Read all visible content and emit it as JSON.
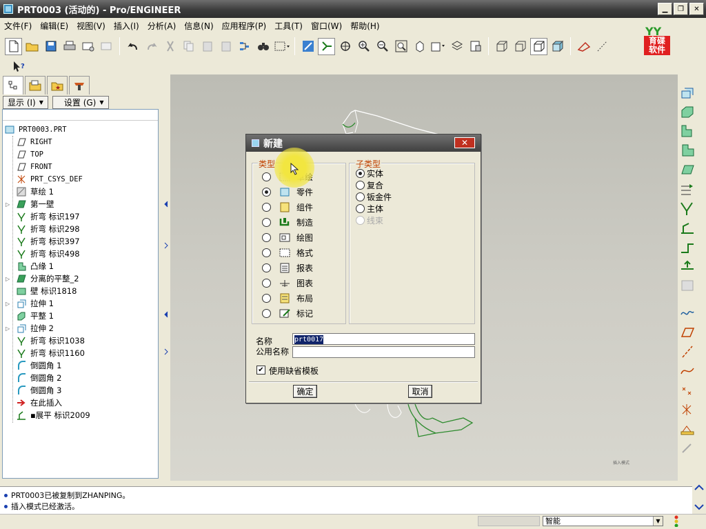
{
  "window": {
    "title": "PRT0003 (活动的) - Pro/ENGINEER",
    "min": "▁",
    "max": "❐",
    "close": "✕"
  },
  "menu": [
    "文件(F)",
    "编辑(E)",
    "视图(V)",
    "插入(I)",
    "分析(A)",
    "信息(N)",
    "应用程序(P)",
    "工具(T)",
    "窗口(W)",
    "帮助(H)"
  ],
  "logo": {
    "line1": "YY",
    "line2": "育碟\n软件"
  },
  "panel": {
    "show_label": "显示 (I)",
    "settings_label": "设置 (G)",
    "tree": [
      {
        "label": "PRT0003.PRT",
        "icon": "part-icon",
        "indent": 0,
        "expand": false
      },
      {
        "label": "RIGHT",
        "icon": "plane-icon",
        "indent": 1,
        "expand": false
      },
      {
        "label": "TOP",
        "icon": "plane-icon",
        "indent": 1,
        "expand": false
      },
      {
        "label": "FRONT",
        "icon": "plane-icon",
        "indent": 1,
        "expand": false
      },
      {
        "label": "PRT_CSYS_DEF",
        "icon": "csys-icon",
        "indent": 1,
        "expand": false
      },
      {
        "label": "草绘 1",
        "icon": "sketch-icon",
        "indent": 1,
        "expand": false
      },
      {
        "label": "第一壁",
        "icon": "wall-icon",
        "indent": 1,
        "expand": true
      },
      {
        "label": "折弯 标识197",
        "icon": "bend-icon",
        "indent": 1,
        "expand": false
      },
      {
        "label": "折弯 标识298",
        "icon": "bend-icon",
        "indent": 1,
        "expand": false
      },
      {
        "label": "折弯 标识397",
        "icon": "bend-icon",
        "indent": 1,
        "expand": false
      },
      {
        "label": "折弯 标识498",
        "icon": "bend-icon",
        "indent": 1,
        "expand": false
      },
      {
        "label": "凸缘 1",
        "icon": "flange-icon",
        "indent": 1,
        "expand": false
      },
      {
        "label": "分离的平整_2",
        "icon": "wall-icon",
        "indent": 1,
        "expand": true
      },
      {
        "label": "壁 标识1818",
        "icon": "wall2-icon",
        "indent": 1,
        "expand": false
      },
      {
        "label": "拉伸 1",
        "icon": "extrude-icon",
        "indent": 1,
        "expand": true
      },
      {
        "label": "平整 1",
        "icon": "flat-icon",
        "indent": 1,
        "expand": false
      },
      {
        "label": "拉伸 2",
        "icon": "extrude-icon",
        "indent": 1,
        "expand": true
      },
      {
        "label": "折弯 标识1038",
        "icon": "bend-icon",
        "indent": 1,
        "expand": false
      },
      {
        "label": "折弯 标识1160",
        "icon": "bend-icon",
        "indent": 1,
        "expand": false
      },
      {
        "label": "倒圆角 1",
        "icon": "round-icon",
        "indent": 1,
        "expand": false
      },
      {
        "label": "倒圆角 2",
        "icon": "round-icon",
        "indent": 1,
        "expand": false
      },
      {
        "label": "倒圆角 3",
        "icon": "round-icon",
        "indent": 1,
        "expand": false
      },
      {
        "label": "在此插入",
        "icon": "insert-here-icon",
        "indent": 1,
        "expand": false
      },
      {
        "label": "▪展平 标识2009",
        "icon": "unbend-icon",
        "indent": 1,
        "expand": false
      }
    ]
  },
  "dialog": {
    "title": "新建",
    "close": "✕",
    "type_group_label": "类型",
    "types": [
      {
        "label": "草绘",
        "selected": false,
        "icon": "sketch-type-icon"
      },
      {
        "label": "零件",
        "selected": true,
        "icon": "part-type-icon"
      },
      {
        "label": "组件",
        "selected": false,
        "icon": "assembly-type-icon"
      },
      {
        "label": "制造",
        "selected": false,
        "icon": "manufacturing-type-icon"
      },
      {
        "label": "绘图",
        "selected": false,
        "icon": "drawing-type-icon"
      },
      {
        "label": "格式",
        "selected": false,
        "icon": "format-type-icon"
      },
      {
        "label": "报表",
        "selected": false,
        "icon": "report-type-icon"
      },
      {
        "label": "图表",
        "selected": false,
        "icon": "diagram-type-icon"
      },
      {
        "label": "布局",
        "selected": false,
        "icon": "layout-type-icon"
      },
      {
        "label": "标记",
        "selected": false,
        "icon": "markup-type-icon"
      }
    ],
    "subtype_group_label": "子类型",
    "subtypes": [
      {
        "label": "实体",
        "selected": true,
        "disabled": false
      },
      {
        "label": "复合",
        "selected": false,
        "disabled": false
      },
      {
        "label": "钣金件",
        "selected": false,
        "disabled": false
      },
      {
        "label": "主体",
        "selected": false,
        "disabled": false
      },
      {
        "label": "线束",
        "selected": false,
        "disabled": true
      }
    ],
    "name_label": "名称",
    "name_value": "prt0017",
    "common_name_label": "公用名称",
    "common_name_value": "",
    "use_template_label": "使用缺省模板",
    "use_template_checked": true,
    "ok_label": "确定",
    "cancel_label": "取消"
  },
  "viewport": {
    "watermark": "插入模式"
  },
  "status": {
    "messages": [
      "PRT0003已被复制到ZHANPING。",
      "插入模式已经激活。"
    ],
    "filter_value": "智能"
  },
  "colors": {
    "title_bar": "#404040",
    "group_label": "#c04000",
    "model_line": "#2d8a2d",
    "viewport_bg": "#c8c7bf"
  }
}
